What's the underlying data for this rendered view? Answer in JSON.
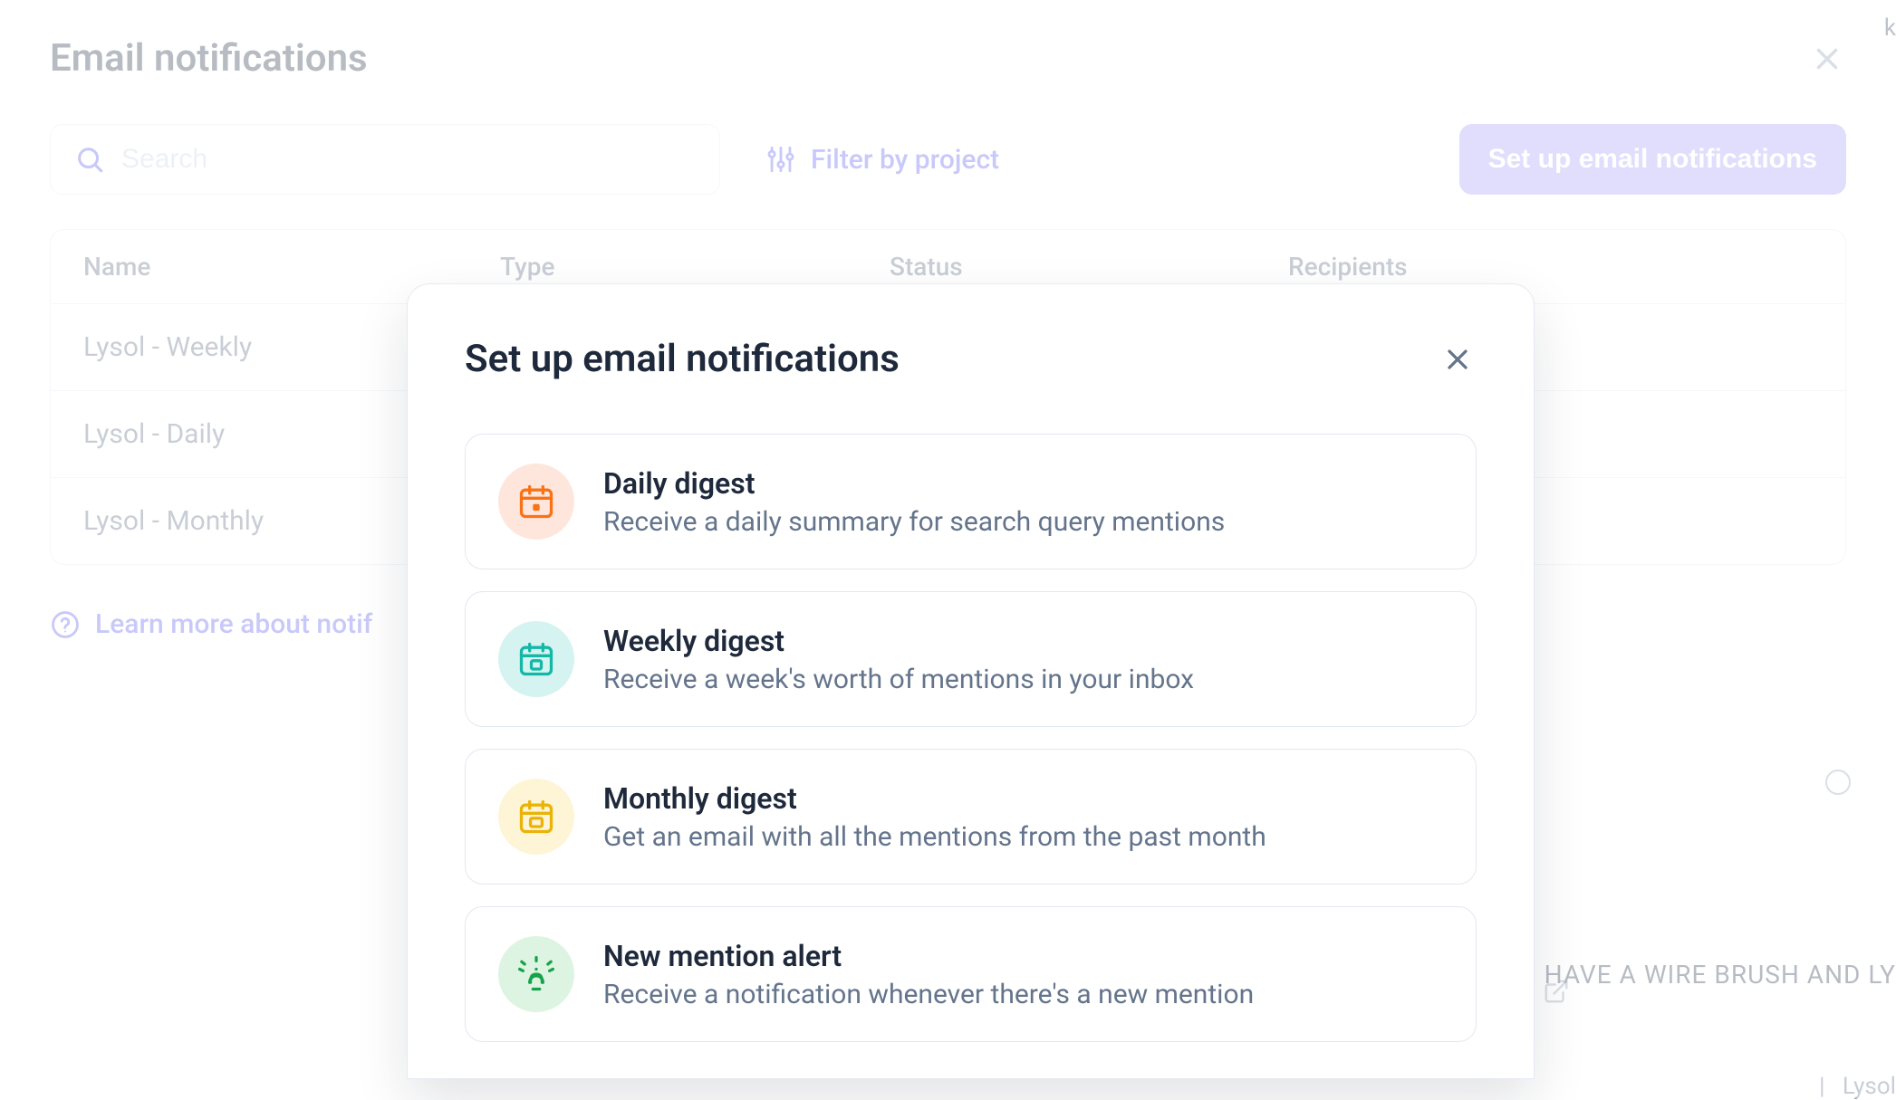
{
  "page": {
    "title": "Email notifications",
    "search_placeholder": "Search",
    "filter_label": "Filter by project",
    "setup_button": "Set up email notifications",
    "learn_more": "Learn more about notif"
  },
  "table": {
    "columns": {
      "name": "Name",
      "type": "Type",
      "status": "Status",
      "recipients": "Recipients"
    },
    "rows": [
      {
        "name": "Lysol - Weekly"
      },
      {
        "name": "Lysol - Daily"
      },
      {
        "name": "Lysol - Monthly"
      }
    ]
  },
  "modal": {
    "title": "Set up email notifications",
    "options": [
      {
        "id": "daily",
        "title": "Daily digest",
        "desc": "Receive a daily summary for search query mentions"
      },
      {
        "id": "weekly",
        "title": "Weekly digest",
        "desc": "Receive a week's worth of mentions in your inbox"
      },
      {
        "id": "monthly",
        "title": "Monthly digest",
        "desc": "Get an email with all the mentions from the past month"
      },
      {
        "id": "alert",
        "title": "New mention alert",
        "desc": "Receive a notification whenever there's a new mention"
      }
    ]
  },
  "background": {
    "snippet": "USE. I HAVE A WIRE BRUSH AND LY",
    "tag": "Lysol",
    "separator": "|",
    "k": "k"
  },
  "colors": {
    "primary": "#6366f1",
    "muted": "#64748b",
    "border": "#e2e8f0"
  }
}
